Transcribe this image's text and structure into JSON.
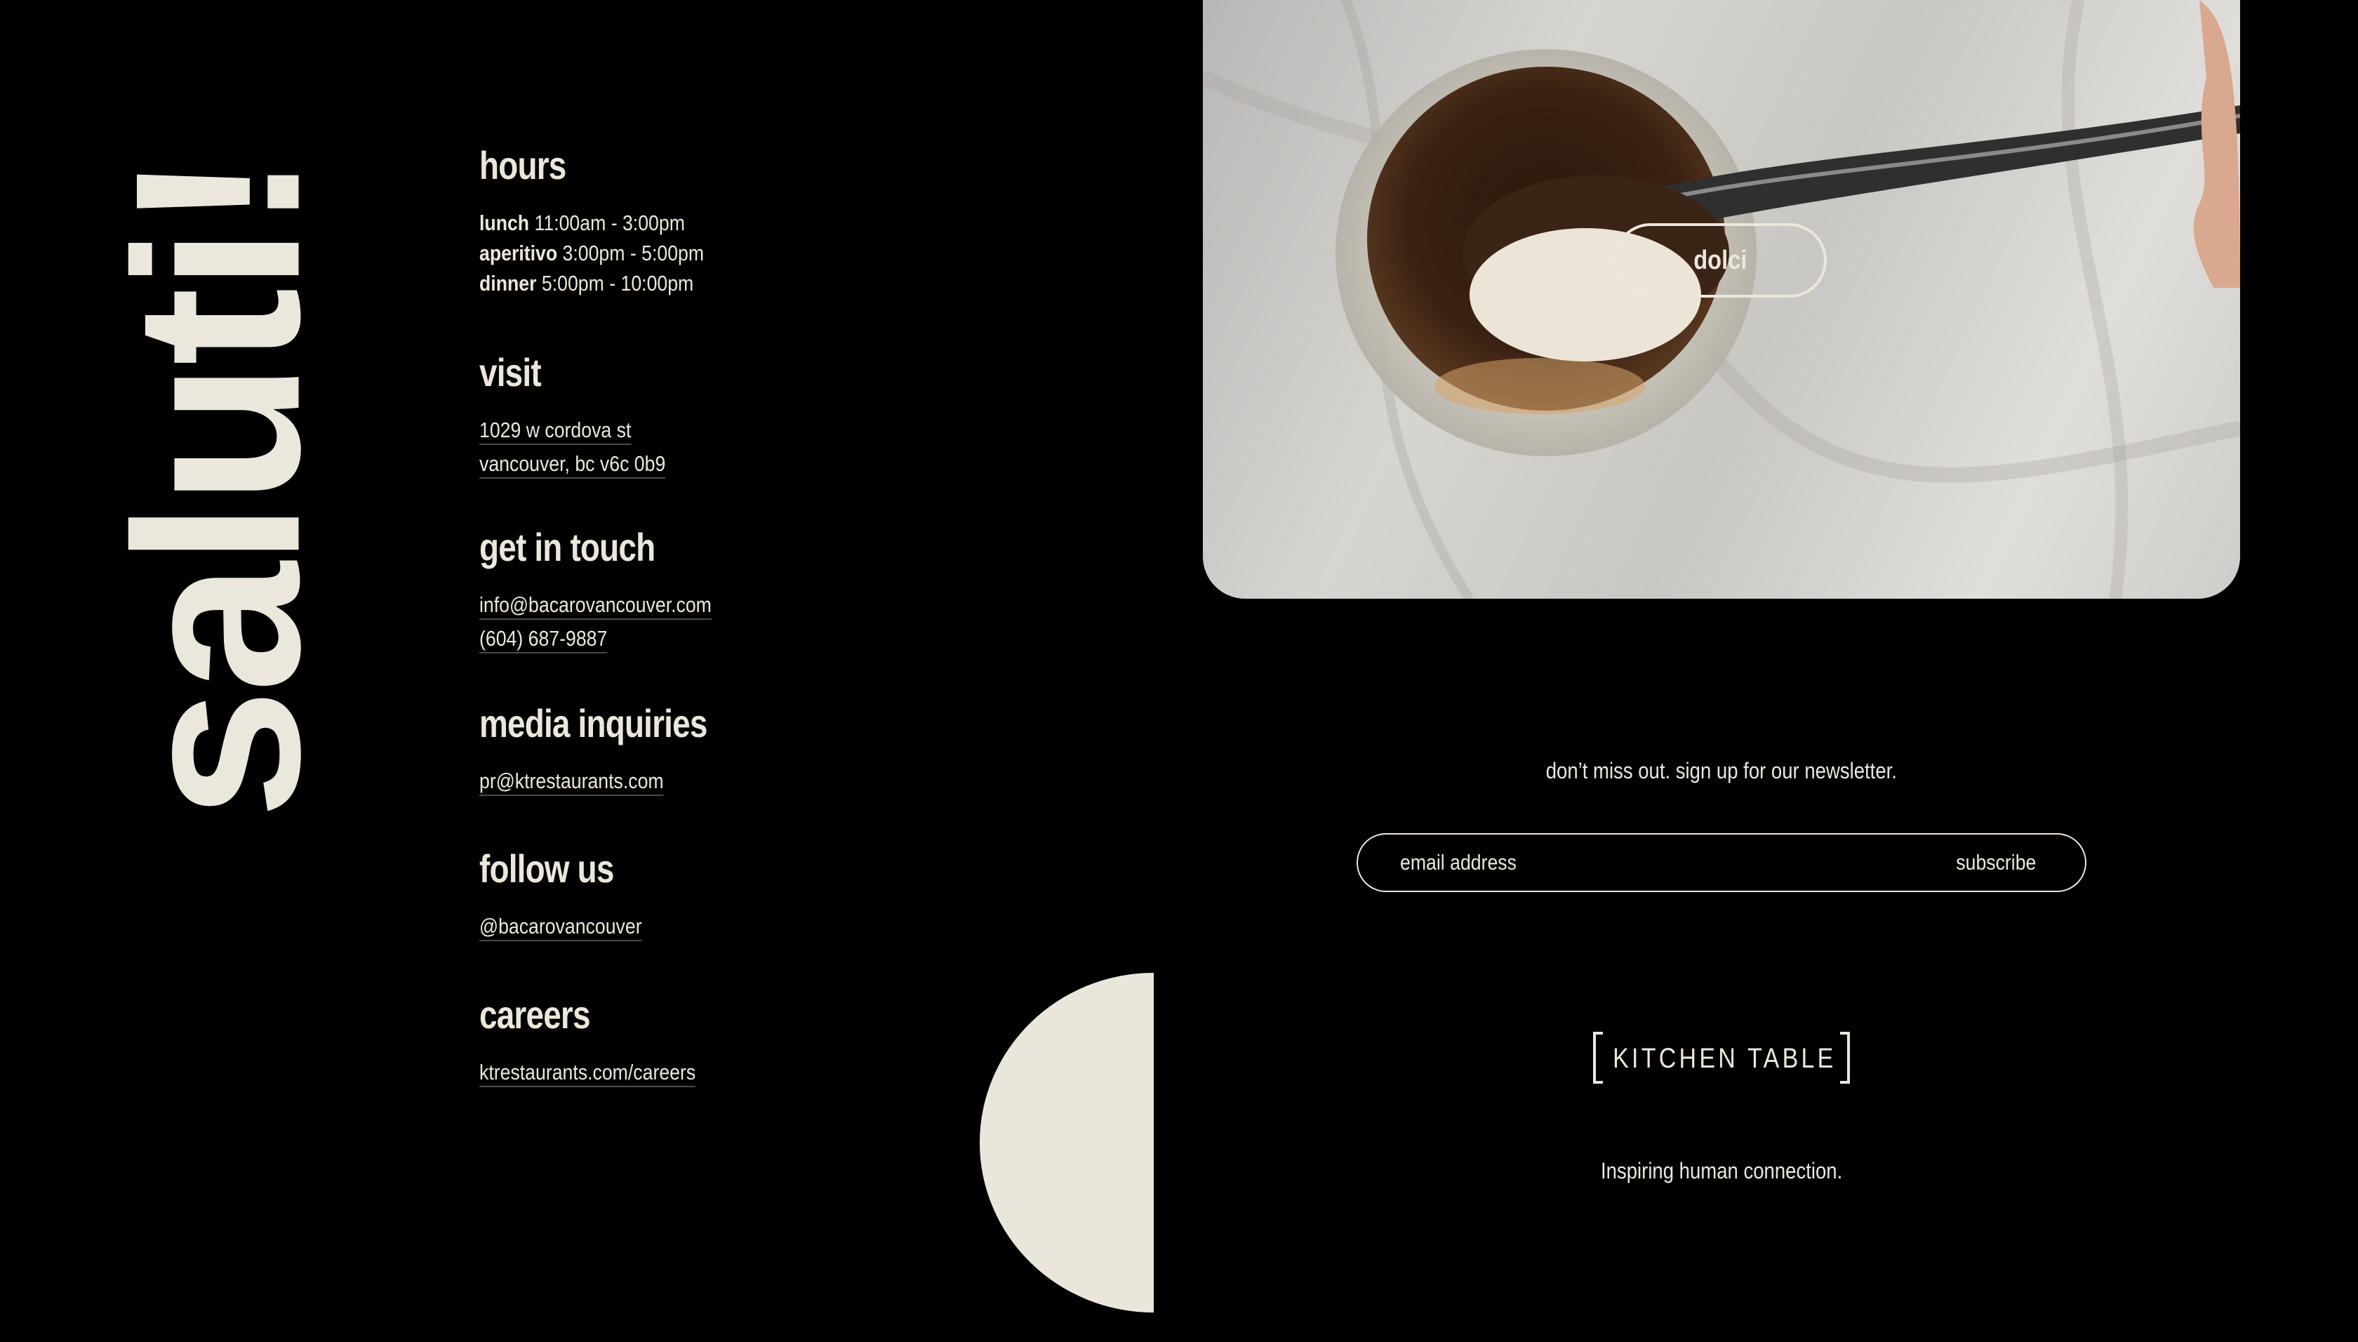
{
  "salutation": "saluti!",
  "sections": {
    "hours": {
      "heading": "hours",
      "items": [
        {
          "label": "lunch",
          "value": "11:00am - 3:00pm"
        },
        {
          "label": "aperitivo",
          "value": "3:00pm - 5:00pm"
        },
        {
          "label": "dinner",
          "value": "5:00pm - 10:00pm"
        }
      ]
    },
    "visit": {
      "heading": "visit",
      "address_line1": "1029 w cordova st",
      "address_line2": "vancouver, bc v6c 0b9"
    },
    "contact": {
      "heading": "get in touch",
      "email": "info@bacarovancouver.com",
      "phone": "(604) 687-9887"
    },
    "media": {
      "heading": "media inquiries",
      "email": "pr@ktrestaurants.com"
    },
    "follow": {
      "heading": "follow us",
      "handle": "@bacarovancouver"
    },
    "careers": {
      "heading": "careers",
      "link": "ktrestaurants.com/careers"
    }
  },
  "photo": {
    "button_label": "dolci"
  },
  "newsletter": {
    "prompt": "don’t miss out. sign up for our newsletter.",
    "placeholder": "email address",
    "button_label": "subscribe"
  },
  "brand": {
    "logo_text": "KITCHEN TABLE",
    "tagline": "Inspiring human connection."
  },
  "colors": {
    "background": "#000000",
    "cream": "#ece7dc"
  }
}
